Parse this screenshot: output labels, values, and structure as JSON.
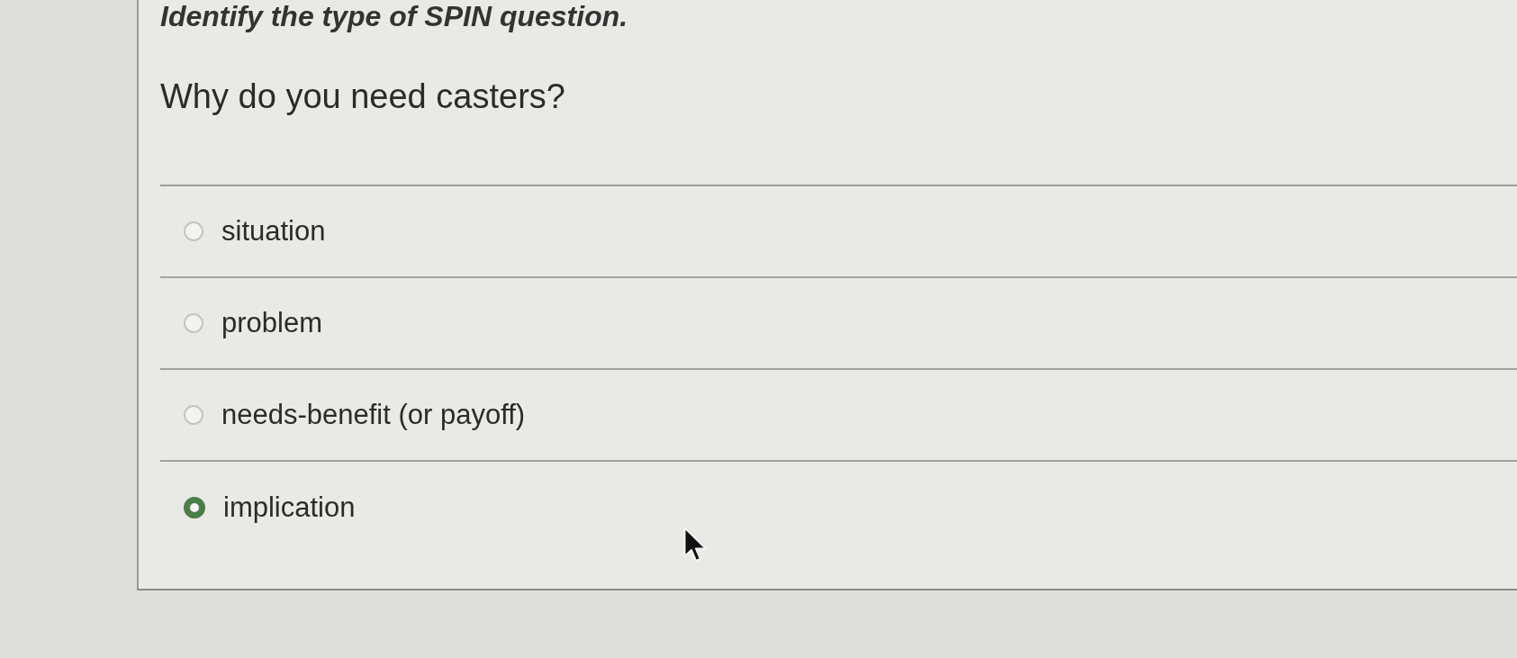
{
  "instruction": "Identify the type of SPIN question.",
  "question": "Why do you need casters?",
  "options": [
    {
      "label": "situation",
      "selected": false
    },
    {
      "label": "problem",
      "selected": false
    },
    {
      "label": "needs-benefit (or payoff)",
      "selected": false
    },
    {
      "label": "implication",
      "selected": true
    }
  ]
}
